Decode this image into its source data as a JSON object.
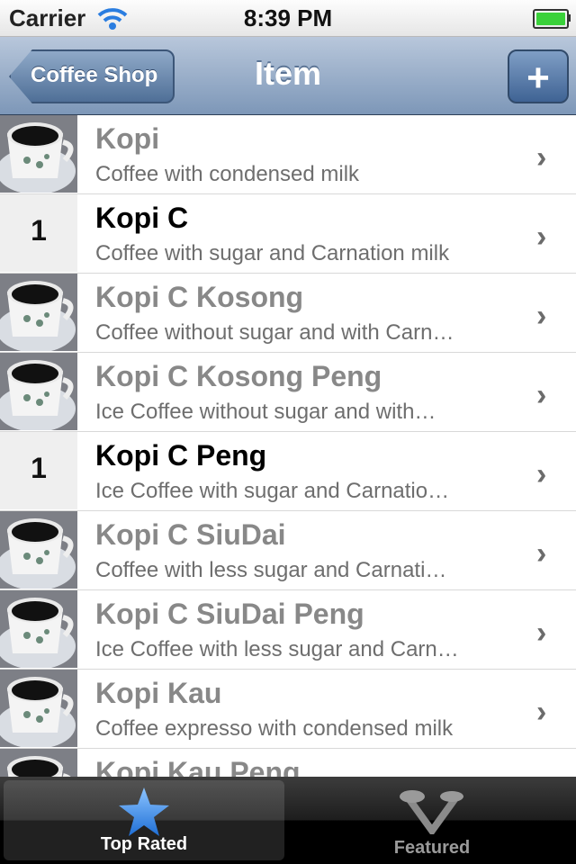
{
  "status_bar": {
    "carrier": "Carrier",
    "time": "8:39 PM"
  },
  "nav": {
    "back_label": "Coffee Shop",
    "title": "Item",
    "add_label": "+"
  },
  "items": [
    {
      "title": "Kopi",
      "subtitle": "Coffee with condensed milk",
      "thumb": "cup",
      "count": ""
    },
    {
      "title": "Kopi C",
      "subtitle": "Coffee with sugar and Carnation milk",
      "thumb": "count",
      "count": "1"
    },
    {
      "title": "Kopi C Kosong",
      "subtitle": "Coffee without sugar and with Carn…",
      "thumb": "cup",
      "count": ""
    },
    {
      "title": "Kopi C Kosong Peng",
      "subtitle": "Ice Coffee without sugar and with…",
      "thumb": "cup",
      "count": ""
    },
    {
      "title": "Kopi C Peng",
      "subtitle": "Ice Coffee with sugar and Carnatio…",
      "thumb": "count",
      "count": "1"
    },
    {
      "title": "Kopi C SiuDai",
      "subtitle": "Coffee with less sugar and Carnati…",
      "thumb": "cup",
      "count": ""
    },
    {
      "title": "Kopi C SiuDai Peng",
      "subtitle": "Ice Coffee with less sugar and Carn…",
      "thumb": "cup",
      "count": ""
    },
    {
      "title": "Kopi Kau",
      "subtitle": "Coffee expresso with condensed milk",
      "thumb": "cup",
      "count": ""
    },
    {
      "title": "Kopi Kau Peng",
      "subtitle": "",
      "thumb": "cup",
      "count": ""
    }
  ],
  "tabs": [
    {
      "label": "Top Rated",
      "icon": "star-icon",
      "selected": true
    },
    {
      "label": "Featured",
      "icon": "featured-icon",
      "selected": false
    }
  ],
  "colors": {
    "nav_top": "#b8c7db",
    "nav_bottom": "#7d97b8",
    "battery": "#3ad13a",
    "star": "#3a8ee8"
  }
}
